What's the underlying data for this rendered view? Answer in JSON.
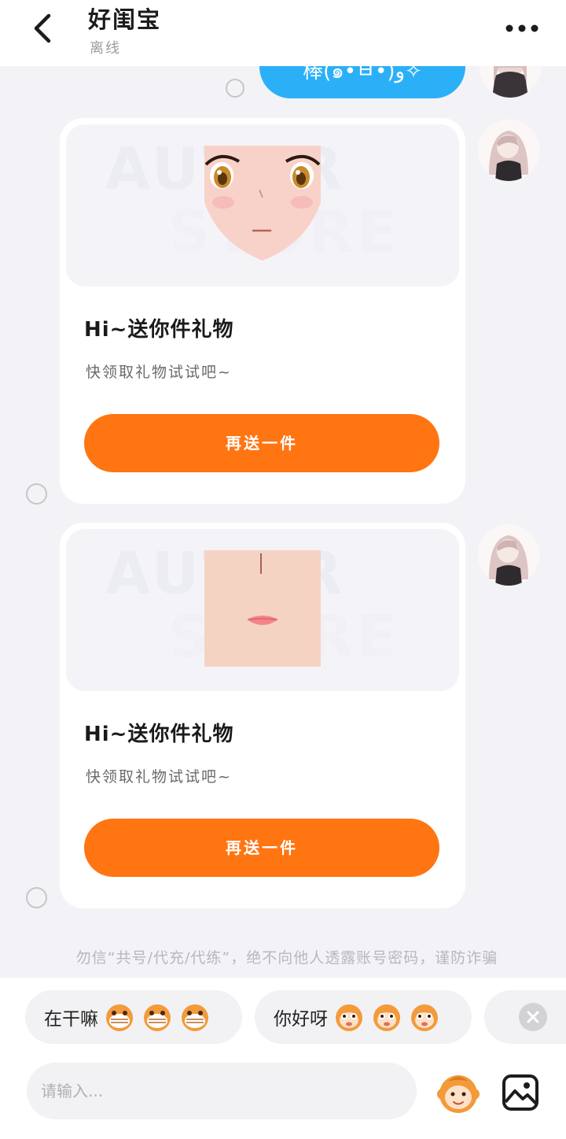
{
  "header": {
    "title": "好闺宝",
    "status": "离线",
    "back_icon": "chevron-left-icon",
    "more_icon": "more-dots-icon"
  },
  "messages": {
    "top_bubble_text": "棒(๑•̀ㅂ•́)و✧",
    "gift_cards": [
      {
        "title": "Hi~送你件礼物",
        "description": "快领取礼物试试吧~",
        "button_label": "再送一件",
        "watermark_top": "AUTOR",
        "watermark_bottom": "STORE"
      },
      {
        "title": "Hi~送你件礼物",
        "description": "快领取礼物试试吧~",
        "button_label": "再送一件",
        "watermark_top": "AUTOR",
        "watermark_bottom": "STORE"
      }
    ],
    "notice": "勿信“共号/代充/代练”，绝不向他人透露账号密码，谨防诈骗"
  },
  "quick_replies": [
    {
      "text": "在干嘛"
    },
    {
      "text": "你好呀"
    }
  ],
  "input": {
    "placeholder": "请输入..."
  },
  "colors": {
    "accent_orange": "#ff7512",
    "bubble_blue": "#2bb0f8"
  }
}
